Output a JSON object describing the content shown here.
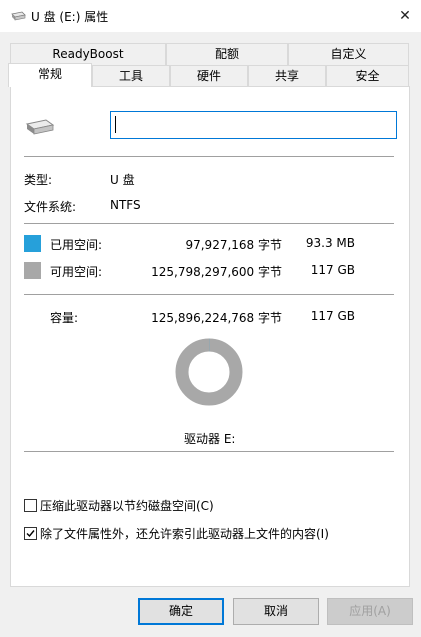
{
  "window": {
    "title": "U 盘 (E:) 属性",
    "close_glyph": "✕"
  },
  "tabs": {
    "row1": [
      "ReadyBoost",
      "配额",
      "自定义"
    ],
    "row2": [
      "常规",
      "工具",
      "硬件",
      "共享",
      "安全"
    ],
    "active": "常规"
  },
  "general": {
    "drive_name_value": "",
    "type_label": "类型:",
    "type_value": "U 盘",
    "fs_label": "文件系统:",
    "fs_value": "NTFS",
    "used_label": "已用空间:",
    "used_bytes": "97,927,168 字节",
    "used_size": "93.3 MB",
    "free_label": "可用空间:",
    "free_bytes": "125,798,297,600 字节",
    "free_size": "117 GB",
    "capacity_label": "容量:",
    "capacity_bytes": "125,896,224,768 字节",
    "capacity_size": "117 GB",
    "drive_caption": "驱动器 E:",
    "used_fraction": 0.000778,
    "used_color": "#26a0da",
    "free_color": "#a8a8a8",
    "compress_label": "压缩此驱动器以节约磁盘空间(C)",
    "compress_checked": false,
    "index_label": "除了文件属性外，还允许索引此驱动器上文件的内容(I)",
    "index_checked": true
  },
  "buttons": {
    "ok": "确定",
    "cancel": "取消",
    "apply": "应用(A)"
  },
  "icons": {
    "title": "drive-icon",
    "drive": "usb-drive-icon",
    "close": "close-icon"
  }
}
